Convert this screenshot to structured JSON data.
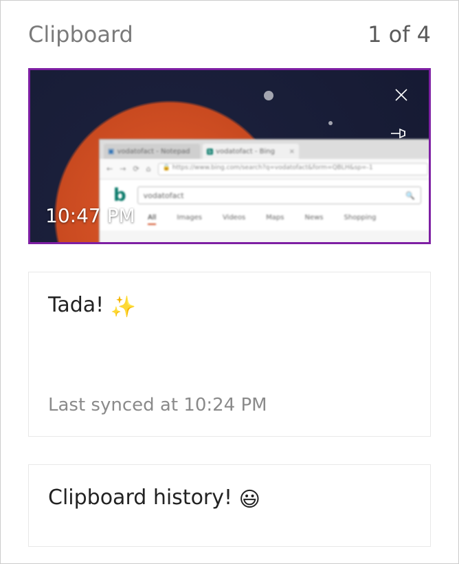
{
  "header": {
    "title": "Clipboard",
    "counter": "1 of 4"
  },
  "items": [
    {
      "type": "image",
      "timestamp": "10:47 PM",
      "selected": true,
      "close_label": "Delete",
      "pin_label": "Pin"
    },
    {
      "type": "text",
      "text": "Tada! ",
      "emoji": "✨",
      "sync_status": "Last synced at 10:24 PM"
    },
    {
      "type": "text",
      "text": "Clipboard history! ",
      "emoji": "😃"
    }
  ],
  "thumbnail": {
    "tab1": "vodatofact - Notepad",
    "tab2": "vodatofact - Bing",
    "url": "https://www.bing.com/search?q=vodatofact&form=QBLH&sp=-1",
    "search_text": "vodatofact",
    "nav": [
      "All",
      "Images",
      "Videos",
      "Maps",
      "News",
      "Shopping"
    ]
  }
}
